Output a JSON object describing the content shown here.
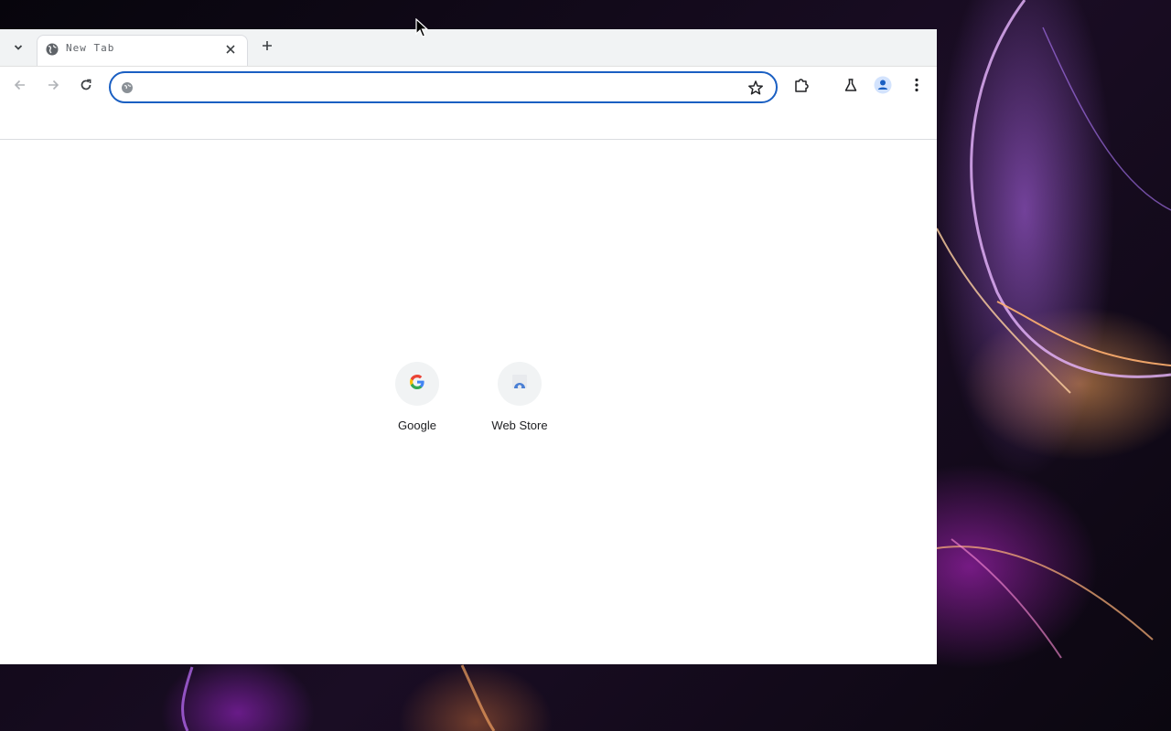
{
  "browser": {
    "tab": {
      "title": "New Tab",
      "favicon": "globe-icon"
    },
    "icons": {
      "tab_search": "chevron-down-icon",
      "tab_close": "close-icon",
      "new_tab": "plus-icon",
      "back": "arrow-left-icon",
      "forward": "arrow-right-icon",
      "reload": "reload-icon",
      "bookmark": "star-icon",
      "extensions": "puzzle-icon",
      "labs": "flask-icon",
      "profile": "person-icon",
      "menu": "kebab-menu-icon"
    },
    "omnibox": {
      "value": "",
      "placeholder": ""
    },
    "colors": {
      "focus_ring": "#1a5fc2",
      "tab_strip": "#f1f3f4",
      "profile_accent": "#1a73e8"
    }
  },
  "ntp": {
    "shortcuts": [
      {
        "label": "Google",
        "icon": "google-g-icon"
      },
      {
        "label": "Web Store",
        "icon": "web-store-icon"
      }
    ]
  }
}
